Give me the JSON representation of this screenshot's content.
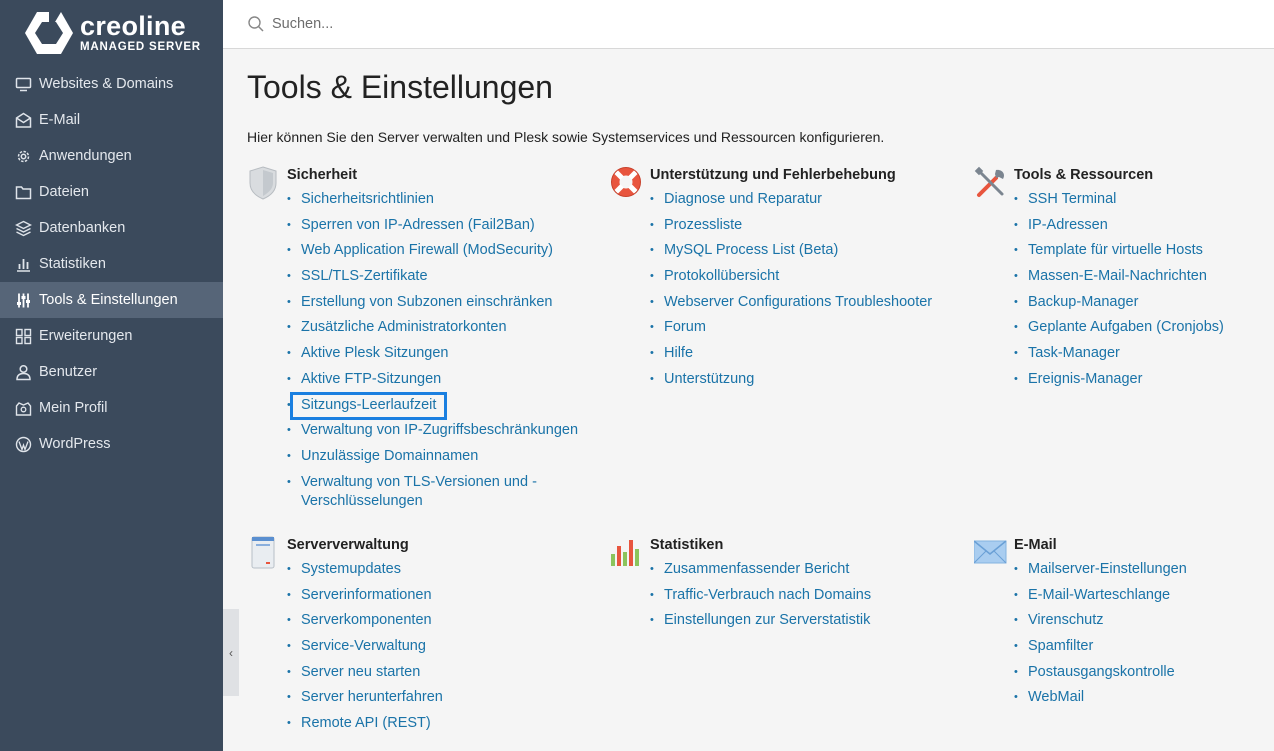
{
  "brand": {
    "name": "creoline",
    "sub": "MANAGED SERVER"
  },
  "sidebar": {
    "items": [
      {
        "label": "Websites & Domains",
        "icon": "monitor-icon"
      },
      {
        "label": "E-Mail",
        "icon": "envelope-icon"
      },
      {
        "label": "Anwendungen",
        "icon": "gear-icon"
      },
      {
        "label": "Dateien",
        "icon": "folder-icon"
      },
      {
        "label": "Datenbanken",
        "icon": "database-icon"
      },
      {
        "label": "Statistiken",
        "icon": "bar-chart-icon"
      },
      {
        "label": "Tools & Einstellungen",
        "icon": "sliders-icon",
        "active": true
      },
      {
        "label": "Erweiterungen",
        "icon": "puzzle-icon"
      },
      {
        "label": "Benutzer",
        "icon": "user-icon"
      },
      {
        "label": "Mein Profil",
        "icon": "profile-icon"
      },
      {
        "label": "WordPress",
        "icon": "wordpress-icon"
      }
    ]
  },
  "search": {
    "placeholder": "Suchen..."
  },
  "page": {
    "title": "Tools & Einstellungen",
    "description": "Hier können Sie den Server verwalten und Plesk sowie Systemservices und Ressourcen konfigurieren."
  },
  "sections": {
    "sicherheit": {
      "title": "Sicherheit",
      "items": [
        "Sicherheitsrichtlinien",
        "Sperren von IP-Adressen (Fail2Ban)",
        "Web Application Firewall (ModSecurity)",
        "SSL/TLS-Zertifikate",
        "Erstellung von Subzonen einschränken",
        "Zusätzliche Administratorkonten",
        "Aktive Plesk Sitzungen",
        "Aktive FTP-Sitzungen",
        "Sitzungs-Leerlaufzeit",
        "Verwaltung von IP-Zugriffsbeschränkungen",
        "Unzulässige Domainnamen",
        "Verwaltung von TLS-Versionen und -Verschlüsselungen"
      ]
    },
    "support": {
      "title": "Unterstützung und Fehlerbehebung",
      "items": [
        "Diagnose und Reparatur",
        "Prozessliste",
        "MySQL Process List (Beta)",
        "Protokollübersicht",
        "Webserver Configurations Troubleshooter",
        "Forum",
        "Hilfe",
        "Unterstützung"
      ]
    },
    "tools": {
      "title": "Tools & Ressourcen",
      "items": [
        "SSH Terminal",
        "IP-Adressen",
        "Template für virtuelle Hosts",
        "Massen-E-Mail-Nachrichten",
        "Backup-Manager",
        "Geplante Aufgaben (Cronjobs)",
        "Task-Manager",
        "Ereignis-Manager"
      ]
    },
    "server": {
      "title": "Serververwaltung",
      "items": [
        "Systemupdates",
        "Serverinformationen",
        "Serverkomponenten",
        "Service-Verwaltung",
        "Server neu starten",
        "Server herunterfahren",
        "Remote API (REST)"
      ]
    },
    "stats": {
      "title": "Statistiken",
      "items": [
        "Zusammenfassender Bericht",
        "Traffic-Verbrauch nach Domains",
        "Einstellungen zur Serverstatistik"
      ]
    },
    "email": {
      "title": "E-Mail",
      "items": [
        "Mailserver-Einstellungen",
        "E-Mail-Warteschlange",
        "Virenschutz",
        "Spamfilter",
        "Postausgangskontrolle",
        "WebMail"
      ]
    }
  },
  "highlighted_item": "Sitzungs-Leerlaufzeit"
}
